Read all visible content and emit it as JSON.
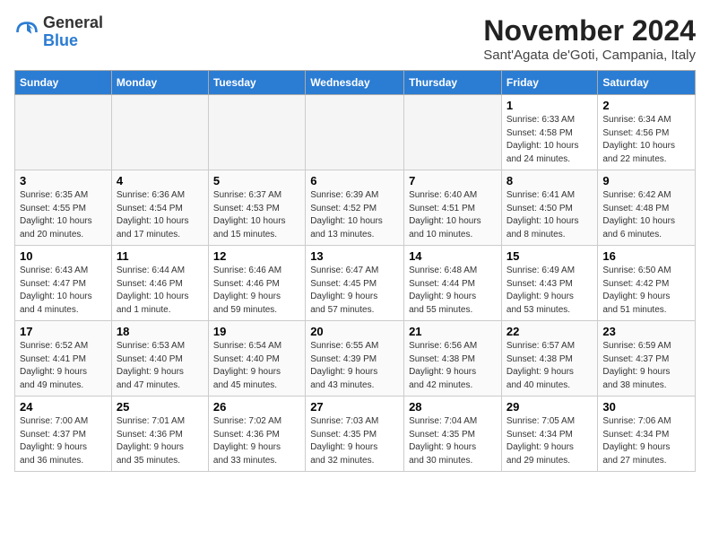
{
  "header": {
    "logo_general": "General",
    "logo_blue": "Blue",
    "month_title": "November 2024",
    "location": "Sant'Agata de'Goti, Campania, Italy"
  },
  "calendar": {
    "days_of_week": [
      "Sunday",
      "Monday",
      "Tuesday",
      "Wednesday",
      "Thursday",
      "Friday",
      "Saturday"
    ],
    "weeks": [
      [
        {
          "day": "",
          "info": ""
        },
        {
          "day": "",
          "info": ""
        },
        {
          "day": "",
          "info": ""
        },
        {
          "day": "",
          "info": ""
        },
        {
          "day": "",
          "info": ""
        },
        {
          "day": "1",
          "info": "Sunrise: 6:33 AM\nSunset: 4:58 PM\nDaylight: 10 hours\nand 24 minutes."
        },
        {
          "day": "2",
          "info": "Sunrise: 6:34 AM\nSunset: 4:56 PM\nDaylight: 10 hours\nand 22 minutes."
        }
      ],
      [
        {
          "day": "3",
          "info": "Sunrise: 6:35 AM\nSunset: 4:55 PM\nDaylight: 10 hours\nand 20 minutes."
        },
        {
          "day": "4",
          "info": "Sunrise: 6:36 AM\nSunset: 4:54 PM\nDaylight: 10 hours\nand 17 minutes."
        },
        {
          "day": "5",
          "info": "Sunrise: 6:37 AM\nSunset: 4:53 PM\nDaylight: 10 hours\nand 15 minutes."
        },
        {
          "day": "6",
          "info": "Sunrise: 6:39 AM\nSunset: 4:52 PM\nDaylight: 10 hours\nand 13 minutes."
        },
        {
          "day": "7",
          "info": "Sunrise: 6:40 AM\nSunset: 4:51 PM\nDaylight: 10 hours\nand 10 minutes."
        },
        {
          "day": "8",
          "info": "Sunrise: 6:41 AM\nSunset: 4:50 PM\nDaylight: 10 hours\nand 8 minutes."
        },
        {
          "day": "9",
          "info": "Sunrise: 6:42 AM\nSunset: 4:48 PM\nDaylight: 10 hours\nand 6 minutes."
        }
      ],
      [
        {
          "day": "10",
          "info": "Sunrise: 6:43 AM\nSunset: 4:47 PM\nDaylight: 10 hours\nand 4 minutes."
        },
        {
          "day": "11",
          "info": "Sunrise: 6:44 AM\nSunset: 4:46 PM\nDaylight: 10 hours\nand 1 minute."
        },
        {
          "day": "12",
          "info": "Sunrise: 6:46 AM\nSunset: 4:46 PM\nDaylight: 9 hours\nand 59 minutes."
        },
        {
          "day": "13",
          "info": "Sunrise: 6:47 AM\nSunset: 4:45 PM\nDaylight: 9 hours\nand 57 minutes."
        },
        {
          "day": "14",
          "info": "Sunrise: 6:48 AM\nSunset: 4:44 PM\nDaylight: 9 hours\nand 55 minutes."
        },
        {
          "day": "15",
          "info": "Sunrise: 6:49 AM\nSunset: 4:43 PM\nDaylight: 9 hours\nand 53 minutes."
        },
        {
          "day": "16",
          "info": "Sunrise: 6:50 AM\nSunset: 4:42 PM\nDaylight: 9 hours\nand 51 minutes."
        }
      ],
      [
        {
          "day": "17",
          "info": "Sunrise: 6:52 AM\nSunset: 4:41 PM\nDaylight: 9 hours\nand 49 minutes."
        },
        {
          "day": "18",
          "info": "Sunrise: 6:53 AM\nSunset: 4:40 PM\nDaylight: 9 hours\nand 47 minutes."
        },
        {
          "day": "19",
          "info": "Sunrise: 6:54 AM\nSunset: 4:40 PM\nDaylight: 9 hours\nand 45 minutes."
        },
        {
          "day": "20",
          "info": "Sunrise: 6:55 AM\nSunset: 4:39 PM\nDaylight: 9 hours\nand 43 minutes."
        },
        {
          "day": "21",
          "info": "Sunrise: 6:56 AM\nSunset: 4:38 PM\nDaylight: 9 hours\nand 42 minutes."
        },
        {
          "day": "22",
          "info": "Sunrise: 6:57 AM\nSunset: 4:38 PM\nDaylight: 9 hours\nand 40 minutes."
        },
        {
          "day": "23",
          "info": "Sunrise: 6:59 AM\nSunset: 4:37 PM\nDaylight: 9 hours\nand 38 minutes."
        }
      ],
      [
        {
          "day": "24",
          "info": "Sunrise: 7:00 AM\nSunset: 4:37 PM\nDaylight: 9 hours\nand 36 minutes."
        },
        {
          "day": "25",
          "info": "Sunrise: 7:01 AM\nSunset: 4:36 PM\nDaylight: 9 hours\nand 35 minutes."
        },
        {
          "day": "26",
          "info": "Sunrise: 7:02 AM\nSunset: 4:36 PM\nDaylight: 9 hours\nand 33 minutes."
        },
        {
          "day": "27",
          "info": "Sunrise: 7:03 AM\nSunset: 4:35 PM\nDaylight: 9 hours\nand 32 minutes."
        },
        {
          "day": "28",
          "info": "Sunrise: 7:04 AM\nSunset: 4:35 PM\nDaylight: 9 hours\nand 30 minutes."
        },
        {
          "day": "29",
          "info": "Sunrise: 7:05 AM\nSunset: 4:34 PM\nDaylight: 9 hours\nand 29 minutes."
        },
        {
          "day": "30",
          "info": "Sunrise: 7:06 AM\nSunset: 4:34 PM\nDaylight: 9 hours\nand 27 minutes."
        }
      ]
    ]
  }
}
